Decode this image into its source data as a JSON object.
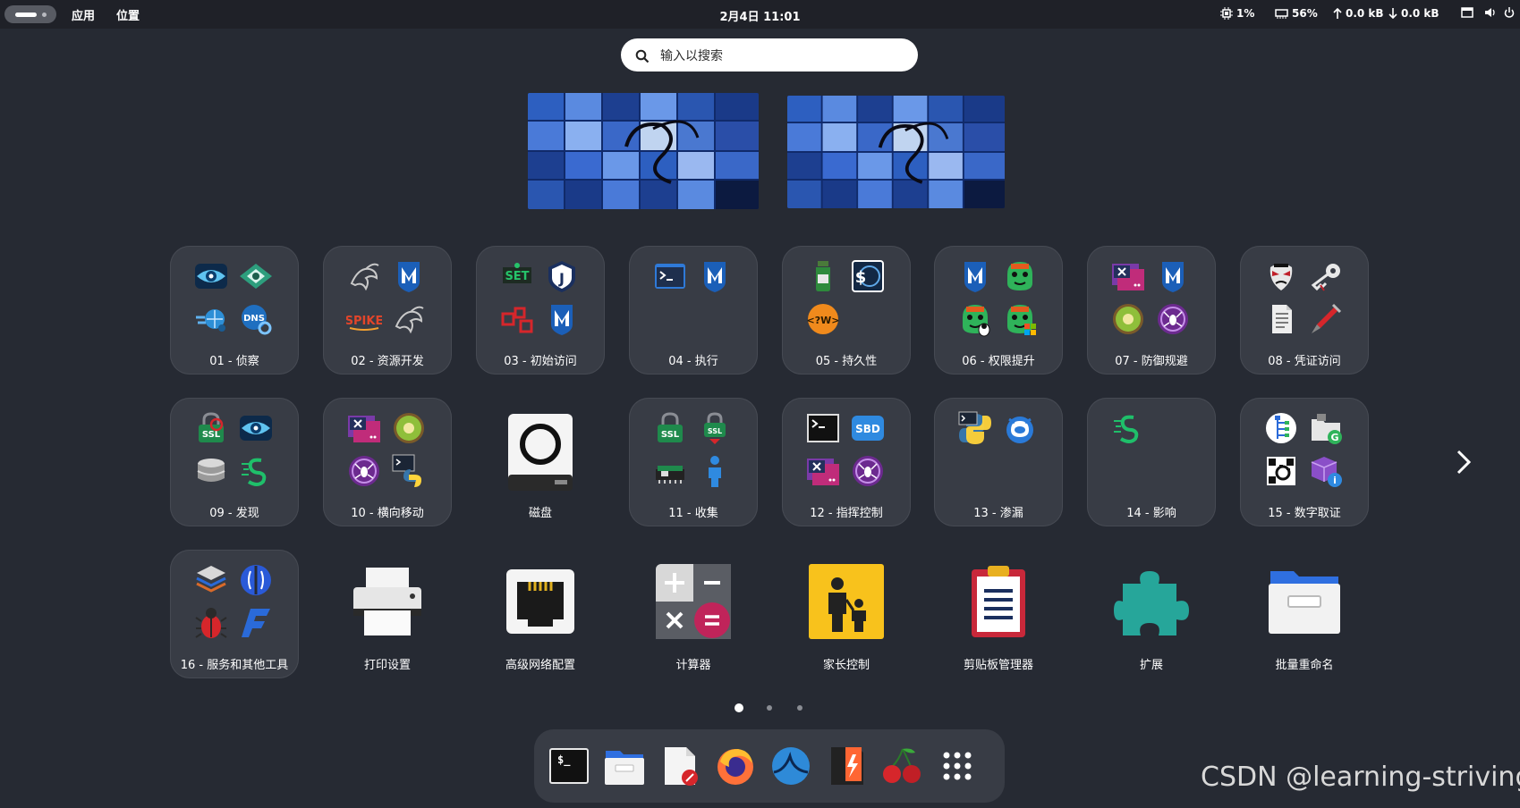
{
  "topbar": {
    "activities_icon": "activities-pill",
    "menus": [
      "应用",
      "位置"
    ],
    "datetime": "2月4日  11:01",
    "cpu": "1%",
    "memory": "56%",
    "net_up": "0.0 kB",
    "net_down": "0.0 kB",
    "tray_icons": [
      "cpu-icon",
      "memory-icon",
      "arrow-up-icon",
      "arrow-down-icon",
      "screen-icon",
      "volume-icon",
      "power-icon"
    ]
  },
  "search": {
    "placeholder": "输入以搜索",
    "icon": "search-icon"
  },
  "workspaces": [
    "workspace-1",
    "workspace-2"
  ],
  "grid": {
    "row1": [
      {
        "label": "01 - 侦察",
        "icons": [
          "eye-icon",
          "radar-eye-icon",
          "network-scan-icon",
          "dns-magnifier-icon"
        ]
      },
      {
        "label": "02 - 资源开发",
        "icons": [
          "kali-dragon-icon",
          "metasploit-icon",
          "spike-icon",
          "kali-dragon-icon"
        ]
      },
      {
        "label": "03 - 初始访问",
        "icons": [
          "set-icon",
          "j-shield-icon",
          "phishing-icon",
          "metasploit-icon"
        ]
      },
      {
        "label": "04 - 执行",
        "icons": [
          "terminal-icon",
          "metasploit-icon"
        ]
      },
      {
        "label": "05 - 持久性",
        "icons": [
          "potion-bottle-icon",
          "shell-globe-icon",
          "php-webshell-icon"
        ]
      },
      {
        "label": "06 - 权限提升",
        "icons": [
          "metasploit-icon",
          "green-monster-icon",
          "green-monster-linux-icon",
          "green-monster-windows-icon"
        ]
      },
      {
        "label": "07 - 防御规避",
        "icons": [
          "window-close-icon",
          "metasploit-icon",
          "kiwi-icon",
          "spider-icon"
        ]
      },
      {
        "label": "08 - 凭证访问",
        "icons": [
          "hacker-mask-icon",
          "key-icon",
          "document-icon",
          "syringe-icon"
        ]
      }
    ],
    "row2": [
      {
        "label": "09 - 发现",
        "icons": [
          "ssl-search-icon",
          "eye-icon",
          "database-icon",
          "s-cable-icon"
        ]
      },
      {
        "label": "10 - 横向移动",
        "icons": [
          "window-close-icon",
          "kiwi-icon",
          "spider-icon",
          "python-terminal-icon"
        ]
      },
      {
        "label": "磁盘",
        "icons": [
          "disk-icon"
        ],
        "single": true
      },
      {
        "label": "11 - 收集",
        "icons": [
          "ssl-lock-icon",
          "ssl-red-lock-icon",
          "network-card-icon",
          "person-icon"
        ]
      },
      {
        "label": "12 - 指挥控制",
        "icons": [
          "terminal-icon",
          "sbd-icon",
          "window-close-icon",
          "spider-icon"
        ]
      },
      {
        "label": "13 - 渗漏",
        "icons": [
          "python-icon",
          "cloud-mask-icon"
        ]
      },
      {
        "label": "14 - 影响",
        "icons": [
          "s-cable-icon"
        ]
      },
      {
        "label": "15 - 数字取证",
        "icons": [
          "tree-icon",
          "folder-g-icon",
          "qr-icon",
          "cube-info-icon"
        ]
      }
    ],
    "row3": [
      {
        "label": "16 - 服务和其他工具",
        "icons": [
          "layers-icon",
          "burp-icon",
          "bug-icon",
          "faraday-icon"
        ]
      },
      {
        "label": "打印设置",
        "icons": [
          "printer-icon"
        ],
        "single": true
      },
      {
        "label": "高级网络配置",
        "icons": [
          "ethernet-icon"
        ],
        "single": true
      },
      {
        "label": "计算器",
        "icons": [
          "calculator-icon"
        ],
        "single": true
      },
      {
        "label": "家长控制",
        "icons": [
          "parental-control-icon"
        ],
        "single": true
      },
      {
        "label": "剪贴板管理器",
        "icons": [
          "clipboard-icon"
        ],
        "single": true
      },
      {
        "label": "扩展",
        "icons": [
          "puzzle-icon"
        ],
        "single": true
      },
      {
        "label": "批量重命名",
        "icons": [
          "file-cabinet-icon"
        ],
        "single": true
      }
    ]
  },
  "pager": {
    "pages": 3,
    "current": 1
  },
  "dash": [
    "terminal-icon",
    "files-icon",
    "text-editor-icon",
    "firefox-icon",
    "wireshark-icon",
    "burp-suite-icon",
    "cherry-icon",
    "app-grid-icon"
  ],
  "watermark": "CSDN @learning-striving",
  "colors": {
    "background": "#262a33",
    "topbar": "#1f2128",
    "folder": "#383c45",
    "accent_blue": "#2a66d9"
  }
}
